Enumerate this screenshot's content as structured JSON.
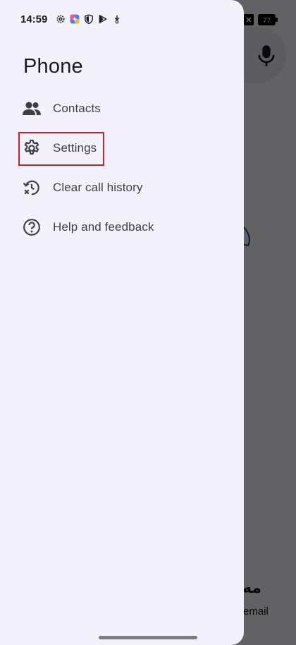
{
  "status_bar": {
    "time": "14:59",
    "battery": "77",
    "left_icons": [
      "gear-icon",
      "photos-icon",
      "shield-icon",
      "play-icon",
      "download-icon"
    ],
    "right_icons": [
      "wifi-icon",
      "close-box-icon",
      "battery-icon"
    ]
  },
  "drawer": {
    "title": "Phone",
    "items": [
      {
        "label": "Contacts",
        "icon": "contacts-icon"
      },
      {
        "label": "Settings",
        "icon": "settings-icon"
      },
      {
        "label": "Clear call history",
        "icon": "clear-history-icon"
      },
      {
        "label": "Help and feedback",
        "icon": "help-icon"
      }
    ]
  },
  "background": {
    "partial_text_1": "مه",
    "partial_text_2": "email"
  },
  "colors": {
    "drawer_bg": "#f3f2fc",
    "highlight": "#cc2027",
    "icon": "#3e3f46",
    "text": "#1b1b1f"
  }
}
